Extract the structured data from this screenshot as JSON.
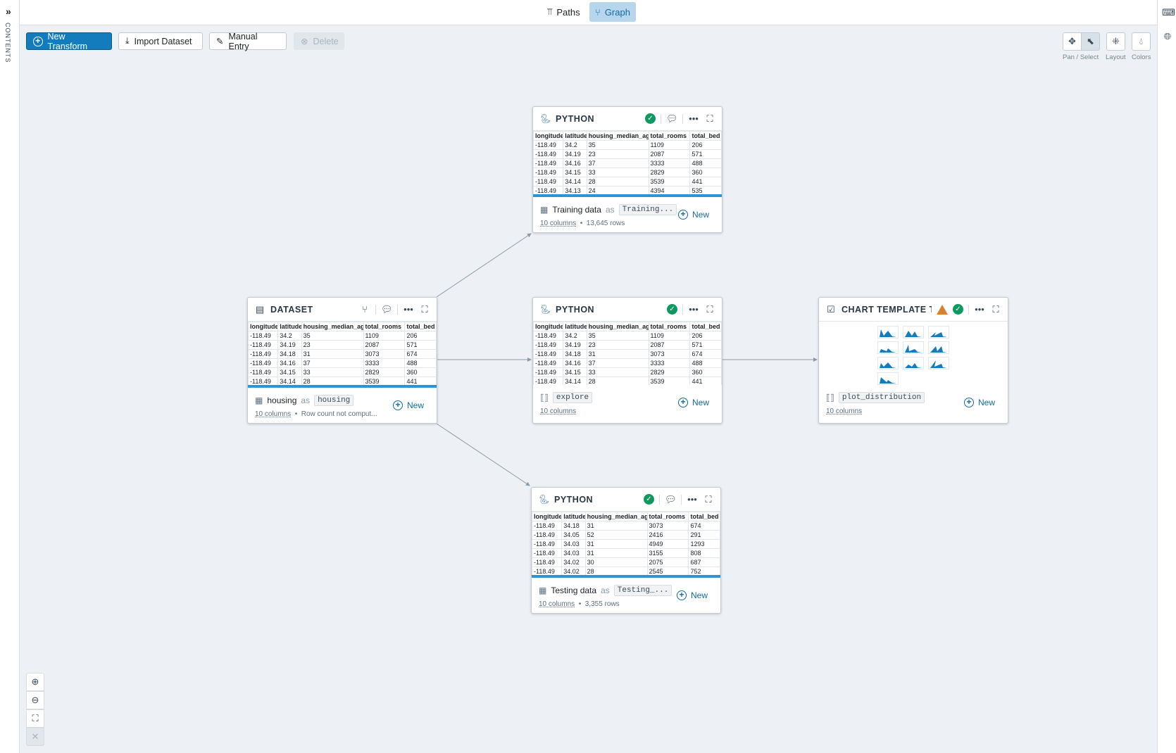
{
  "sidebar": {
    "toggle_icon": "double-chevron-right",
    "label": "CONTENTS"
  },
  "tabs": [
    {
      "label": "Paths",
      "icon": "paths-icon",
      "active": false
    },
    {
      "label": "Graph",
      "icon": "graph-icon",
      "active": true
    }
  ],
  "toolbar": {
    "new_transform": "New Transform",
    "import_dataset": "Import Dataset",
    "manual_entry": "Manual Entry",
    "delete": "Delete"
  },
  "tools": {
    "pan_select": "Pan / Select",
    "layout": "Layout",
    "colors": "Colors"
  },
  "colors": {
    "accent": "#137cbd",
    "success": "#0f9960",
    "warning": "#d9822b",
    "bar": "#2b95d6"
  },
  "columns": [
    "longitude",
    "latitude",
    "housing_median_age",
    "total_rooms",
    "total_bed"
  ],
  "nodes": {
    "dataset": {
      "title": "DATASET",
      "rows": [
        [
          "-118.49",
          "34.2",
          "35",
          "1109",
          "206"
        ],
        [
          "-118.49",
          "34.19",
          "23",
          "2087",
          "571"
        ],
        [
          "-118.49",
          "34.18",
          "31",
          "3073",
          "674"
        ],
        [
          "-118.49",
          "34.16",
          "37",
          "3333",
          "488"
        ],
        [
          "-118.49",
          "34.15",
          "33",
          "2829",
          "360"
        ],
        [
          "-118.49",
          "34.14",
          "28",
          "3539",
          "441"
        ]
      ],
      "name": "housing",
      "as": "as",
      "alias": "housing",
      "columns": "10 columns",
      "rows_info": "Row count not comput...",
      "new": "New"
    },
    "python_top": {
      "title": "PYTHON",
      "rows": [
        [
          "-118.49",
          "34.2",
          "35",
          "1109",
          "206"
        ],
        [
          "-118.49",
          "34.19",
          "23",
          "2087",
          "571"
        ],
        [
          "-118.49",
          "34.16",
          "37",
          "3333",
          "488"
        ],
        [
          "-118.49",
          "34.15",
          "33",
          "2829",
          "360"
        ],
        [
          "-118.49",
          "34.14",
          "28",
          "3539",
          "441"
        ],
        [
          "-118.49",
          "34.13",
          "24",
          "4394",
          "535"
        ]
      ],
      "name": "Training data",
      "as": "as",
      "alias": "Training...",
      "columns": "10 columns",
      "rows_info": "13,645 rows",
      "new": "New"
    },
    "python_mid": {
      "title": "PYTHON",
      "rows": [
        [
          "-118.49",
          "34.2",
          "35",
          "1109",
          "206"
        ],
        [
          "-118.49",
          "34.19",
          "23",
          "2087",
          "571"
        ],
        [
          "-118.49",
          "34.18",
          "31",
          "3073",
          "674"
        ],
        [
          "-118.49",
          "34.16",
          "37",
          "3333",
          "488"
        ],
        [
          "-118.49",
          "34.15",
          "33",
          "2829",
          "360"
        ],
        [
          "-118.49",
          "34.14",
          "28",
          "3539",
          "441"
        ]
      ],
      "alias": "explore",
      "columns": "10 columns",
      "new": "New"
    },
    "python_bottom": {
      "title": "PYTHON",
      "rows": [
        [
          "-118.49",
          "34.18",
          "31",
          "3073",
          "674"
        ],
        [
          "-118.49",
          "34.05",
          "52",
          "2416",
          "291"
        ],
        [
          "-118.49",
          "34.03",
          "31",
          "4949",
          "1293"
        ],
        [
          "-118.49",
          "34.03",
          "31",
          "3155",
          "808"
        ],
        [
          "-118.49",
          "34.02",
          "30",
          "2075",
          "687"
        ],
        [
          "-118.49",
          "34.02",
          "28",
          "2545",
          "752"
        ]
      ],
      "name": "Testing data",
      "as": "as",
      "alias": "Testing_...",
      "columns": "10 columns",
      "rows_info": "3,355 rows",
      "new": "New"
    },
    "chart": {
      "title": "CHART TEMPLATE T...",
      "alias": "plot_distribution",
      "columns": "10 columns",
      "new": "New"
    }
  }
}
